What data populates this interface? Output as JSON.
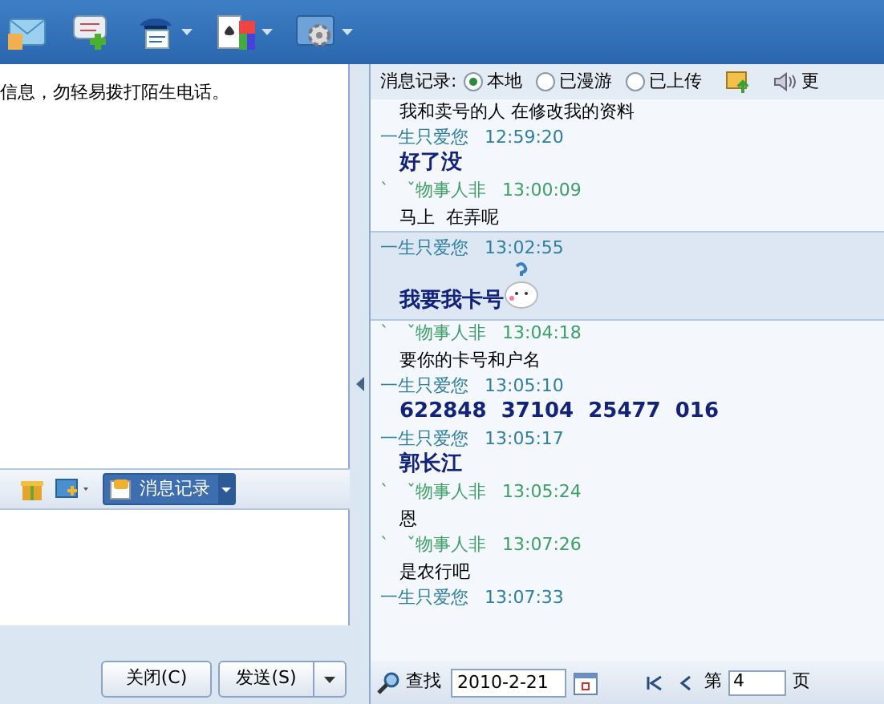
{
  "toolbar": {
    "items": [
      {
        "kind": "plain"
      },
      {
        "kind": "plain"
      },
      {
        "kind": "menu"
      },
      {
        "kind": "menu"
      },
      {
        "kind": "menu"
      }
    ]
  },
  "notice": "信息，勿轻易拨打陌生电话。",
  "input_toolbar": {
    "history_button": "消息记录",
    "history_on": true
  },
  "buttons": {
    "close": "关闭(C)",
    "send": "发送(S)"
  },
  "history": {
    "label": "消息记录:",
    "options": [
      {
        "label": "本地",
        "selected": true
      },
      {
        "label": "已漫游",
        "selected": false
      },
      {
        "label": "已上传",
        "selected": false
      }
    ],
    "speaker_label": "更",
    "messages": [
      {
        "text": "我和卖号的人 在修改我的资料",
        "kind": "plain",
        "highlighted": false,
        "emoticon": false
      },
      {
        "sender": "一生只爱您",
        "color": "#2f7f9f",
        "time": "12:59:20",
        "text": "好了没",
        "kind": "bold",
        "highlighted": false,
        "emoticon": false
      },
      {
        "sender": "`　ˇ物事人非",
        "color": "#3e9f68",
        "time": "13:00:09",
        "text": "马上  在弄呢",
        "kind": "plain",
        "highlighted": false,
        "emoticon": false
      },
      {
        "sender": "一生只爱您",
        "color": "#2f7f9f",
        "time": "13:02:55",
        "text": "我要我卡号",
        "kind": "bold",
        "highlighted": true,
        "emoticon": true
      },
      {
        "sender": "`　ˇ物事人非",
        "color": "#3e9f68",
        "time": "13:04:18",
        "text": "要你的卡号和户名",
        "kind": "plain",
        "highlighted": false,
        "emoticon": false
      },
      {
        "sender": "一生只爱您",
        "color": "#2f7f9f",
        "time": "13:05:10",
        "text": "622848  37104  25477  016",
        "kind": "bold",
        "highlighted": false,
        "emoticon": false
      },
      {
        "sender": "一生只爱您",
        "color": "#2f7f9f",
        "time": "13:05:17",
        "text": "郭长江",
        "kind": "bold",
        "highlighted": false,
        "emoticon": false
      },
      {
        "sender": "`　ˇ物事人非",
        "color": "#3e9f68",
        "time": "13:05:24",
        "text": "恩",
        "kind": "plain",
        "highlighted": false,
        "emoticon": false
      },
      {
        "sender": "`　ˇ物事人非",
        "color": "#3e9f68",
        "time": "13:07:26",
        "text": "是农行吧",
        "kind": "plain",
        "highlighted": false,
        "emoticon": false
      },
      {
        "sender": "一生只爱您",
        "color": "#2f7f9f",
        "time": "13:07:33",
        "highlighted": false
      }
    ],
    "search_label": "查找",
    "date": "2010-2-21",
    "page_prefix": "第",
    "page": "4",
    "page_suffix": "页"
  }
}
